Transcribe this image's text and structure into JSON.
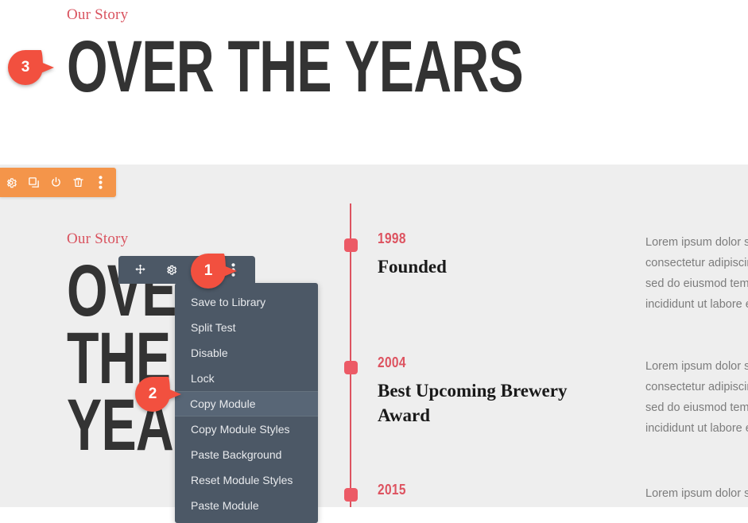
{
  "sections": {
    "top": {
      "eyebrow": "Our Story",
      "heading": "OVER THE YEARS",
      "background": "#ffffff"
    },
    "bottom": {
      "eyebrow": "Our Story",
      "heading": "OVER THE YEARS",
      "background": "#eeeeee"
    }
  },
  "section_toolbar": {
    "background": "#f4954a",
    "icons": [
      {
        "name": "gear-icon",
        "label": "Settings"
      },
      {
        "name": "duplicate-icon",
        "label": "Duplicate"
      },
      {
        "name": "power-icon",
        "label": "Disable"
      },
      {
        "name": "trash-icon",
        "label": "Delete"
      },
      {
        "name": "more-options-icon",
        "label": "More Options"
      }
    ]
  },
  "module_toolbar": {
    "background": "#4c5866",
    "icons": [
      {
        "name": "move-icon",
        "label": "Move Module"
      },
      {
        "name": "gear-icon",
        "label": "Module Settings"
      },
      {
        "name": "duplicate-icon",
        "label": "Duplicate Module"
      },
      {
        "name": "more-options-icon",
        "label": "More Options"
      }
    ]
  },
  "context_menu": {
    "background": "#4c5866",
    "highlight_background": "#586676",
    "items": [
      {
        "label": "Save to Library",
        "active": false
      },
      {
        "label": "Split Test",
        "active": false
      },
      {
        "label": "Disable",
        "active": false
      },
      {
        "label": "Lock",
        "active": false
      },
      {
        "label": "Copy Module",
        "active": true
      },
      {
        "label": "Copy Module Styles",
        "active": false
      },
      {
        "label": "Paste Background",
        "active": false
      },
      {
        "label": "Reset Module Styles",
        "active": false
      },
      {
        "label": "Paste Module",
        "active": false
      }
    ]
  },
  "timeline": {
    "line_color": "#dd5360",
    "node_color": "#ec5a66",
    "entries": [
      {
        "year": "1998",
        "title": "Founded",
        "body": "Lorem ipsum dolor sit amet, consectetur adipiscing elit, sed do eiusmod tempor incididunt ut labore et dolore magna aliqua. Ut enim ad"
      },
      {
        "year": "2004",
        "title": "Best Upcoming Brewery Award",
        "body": "Lorem ipsum dolor sit amet, consectetur adipiscing elit, sed do eiusmod tempor incididunt ut labore et dolore magna aliqua. Ut enim ad"
      },
      {
        "year": "2015",
        "title": "",
        "body": "Lorem ipsum dolor sit amet, consectetur adipiscing elit, sed do eiusmod"
      }
    ]
  },
  "markers": [
    {
      "number": "1",
      "target": "more-options-icon",
      "color": "#f2503f"
    },
    {
      "number": "2",
      "target": "Copy Module",
      "color": "#f2503f"
    },
    {
      "number": "3",
      "target": "OVER THE YEARS",
      "color": "#f2503f"
    }
  ]
}
